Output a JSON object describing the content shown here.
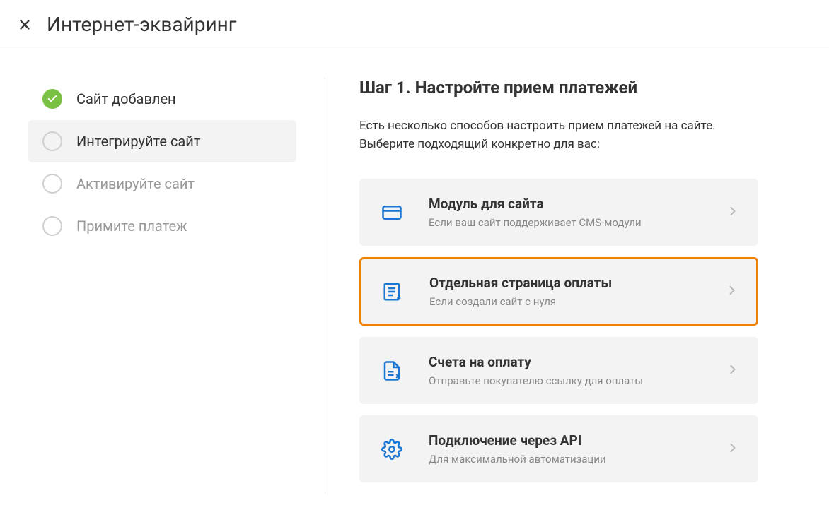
{
  "header": {
    "title": "Интернет-эквайринг"
  },
  "sidebar": {
    "steps": [
      {
        "label": "Сайт добавлен",
        "state": "done"
      },
      {
        "label": "Интегрируйте сайт",
        "state": "active"
      },
      {
        "label": "Активируйте сайт",
        "state": "inactive"
      },
      {
        "label": "Примите платеж",
        "state": "inactive"
      }
    ]
  },
  "main": {
    "title": "Шаг 1. Настройте прием платежей",
    "description": "Есть несколько способов настроить прием платежей на сайте. Выберите подходящий конкретно для вас:",
    "options": [
      {
        "title": "Модуль для сайта",
        "subtitle": "Если ваш сайт поддерживает CMS-модули",
        "icon": "card",
        "highlighted": false
      },
      {
        "title": "Отдельная страница оплаты",
        "subtitle": "Если создали сайт с нуля",
        "icon": "page",
        "highlighted": true
      },
      {
        "title": "Счета на оплату",
        "subtitle": "Отправьте покупателю ссылку для оплаты",
        "icon": "invoice",
        "highlighted": false
      },
      {
        "title": "Подключение через API",
        "subtitle": "Для максимальной автоматизации",
        "icon": "gear",
        "highlighted": false
      }
    ]
  }
}
